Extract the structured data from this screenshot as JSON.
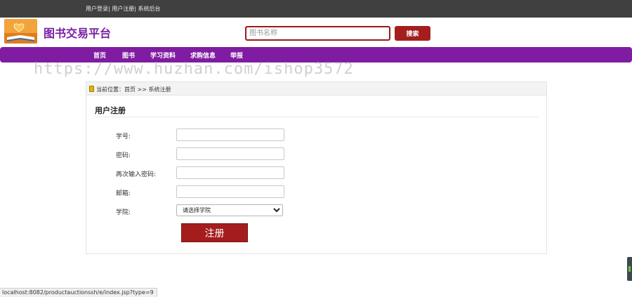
{
  "topbar": {
    "links": [
      "用户登录",
      "用户注册",
      "系统后台"
    ],
    "separator": "|"
  },
  "header": {
    "title": "图书交易平台",
    "logo_icon": "book-logo-icon",
    "search_placeholder": "图书名称",
    "search_button": "搜索"
  },
  "nav": {
    "items": [
      "首页",
      "图书",
      "学习资料",
      "求购信息",
      "举报"
    ]
  },
  "watermark": "https://www.huzhan.com/ishop3572",
  "breadcrumb": {
    "prefix": "当前位置：",
    "path": "首页 >> 系统注册"
  },
  "form": {
    "title": "用户注册",
    "fields": [
      {
        "label": "学号:",
        "value": ""
      },
      {
        "label": "密码:",
        "value": ""
      },
      {
        "label": "再次输入密码:",
        "value": ""
      },
      {
        "label": "邮箱:",
        "value": ""
      }
    ],
    "college": {
      "label": "学院:",
      "selected": "请选择学院"
    },
    "submit": "注册"
  },
  "status_url": "localhost:8082/productauctionssh/e/index.jsp?type=9",
  "colors": {
    "topbar": "#404040",
    "brand_purple": "#7f1ca2",
    "accent_red": "#a41e1e"
  }
}
